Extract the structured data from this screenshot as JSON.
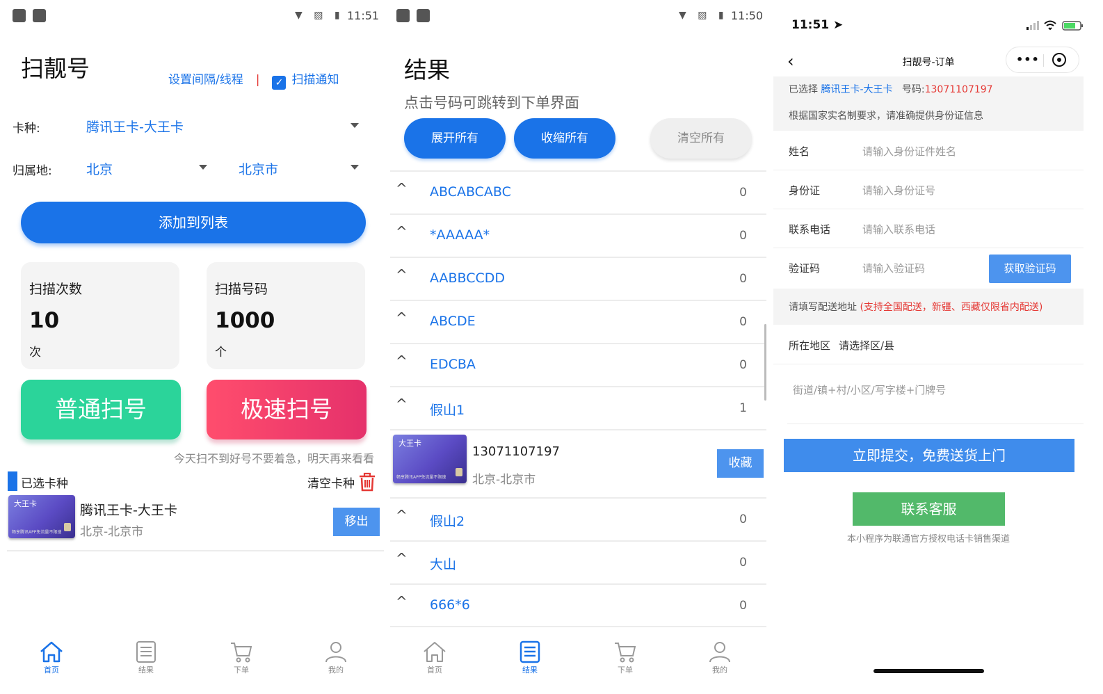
{
  "panel1": {
    "status": {
      "time": "11:51"
    },
    "title": "扫靓号",
    "interval_link": "设置间隔/线程",
    "separator": "|",
    "scan_notify": "扫描通知",
    "card_type_label": "卡种:",
    "card_type_value": "腾讯王卡-大王卡",
    "region_label": "归属地:",
    "province": "北京",
    "city": "北京市",
    "add_button": "添加到列表",
    "stats": [
      {
        "label": "扫描次数",
        "value": "10",
        "unit": "次"
      },
      {
        "label": "扫描号码",
        "value": "1000",
        "unit": "个"
      }
    ],
    "normal_scan": "普通扫号",
    "fast_scan": "极速扫号",
    "tip": "今天扫不到好号不要着急，明天再来看看",
    "selected_title": "已选卡种",
    "clear_types": "清空卡种",
    "selected_card": {
      "card_img_title": "大王卡",
      "card_img_bottom": "畅享腾讯APP免流量不限速",
      "name": "腾讯王卡-大王卡",
      "location": "北京-北京市",
      "remove": "移出"
    },
    "tabs": [
      {
        "label": "首页",
        "icon": "home-icon",
        "active": true
      },
      {
        "label": "结果",
        "icon": "document-icon",
        "active": false
      },
      {
        "label": "下单",
        "icon": "cart-icon",
        "active": false
      },
      {
        "label": "我的",
        "icon": "user-icon",
        "active": false
      }
    ]
  },
  "panel2": {
    "status": {
      "time": "11:50"
    },
    "title": "结果",
    "hint": "点击号码可跳转到下单界面",
    "expand_all": "展开所有",
    "collapse_all": "收缩所有",
    "clear_all": "清空所有",
    "rows_top": [
      {
        "name": "ABCABCABC",
        "count": "0"
      },
      {
        "name": "*AAAAA*",
        "count": "0"
      },
      {
        "name": "AABBCCDD",
        "count": "0"
      },
      {
        "name": "ABCDE",
        "count": "0"
      },
      {
        "name": "EDCBA",
        "count": "0"
      },
      {
        "name": "假山1",
        "count": "1"
      }
    ],
    "item": {
      "card_img_title": "大王卡",
      "card_img_bottom": "畅享腾讯APP免流量不限速",
      "number": "13071107197",
      "location": "北京-北京市",
      "favorite": "收藏"
    },
    "rows_bottom": [
      {
        "name": "假山2",
        "count": "0"
      },
      {
        "name": "大山",
        "count": "0"
      },
      {
        "name": "666*6",
        "count": "0"
      }
    ],
    "tabs": [
      {
        "label": "首页",
        "icon": "home-icon",
        "active": false
      },
      {
        "label": "结果",
        "icon": "document-icon",
        "active": true
      },
      {
        "label": "下单",
        "icon": "cart-icon",
        "active": false
      },
      {
        "label": "我的",
        "icon": "user-icon",
        "active": false
      }
    ]
  },
  "panel3": {
    "status": {
      "time": "11:51"
    },
    "nav_title": "扫靓号-订单",
    "selected_prefix": "已选择",
    "selected_card": "腾讯王卡-大王卡",
    "number_prefix": "号码:",
    "number": "13071107197",
    "id_notice": "根据国家实名制要求，请准确提供身份证信息",
    "fields": [
      {
        "label": "姓名",
        "placeholder": "请输入身份证件姓名"
      },
      {
        "label": "身份证",
        "placeholder": "请输入身份证号"
      },
      {
        "label": "联系电话",
        "placeholder": "请输入联系电话"
      },
      {
        "label": "验证码",
        "placeholder": "请输入验证码"
      }
    ],
    "get_code": "获取验证码",
    "address_notice": "请填写配送地址",
    "address_red": "(支持全国配送，新疆、西藏仅限省内配送)",
    "region_label": "所在地区",
    "region_placeholder": "请选择区/县",
    "street_placeholder": "街道/镇+村/小区/写字楼+门牌号",
    "submit": "立即提交，免费送货上门",
    "service": "联系客服",
    "footnote": "本小程序为联通官方授权电话卡销售渠道"
  },
  "colors": {
    "primary": "#1a73e8",
    "green": "#2bd49a",
    "pink": "#ff4d6d",
    "red": "#e53935",
    "service_green": "#52b96a"
  }
}
